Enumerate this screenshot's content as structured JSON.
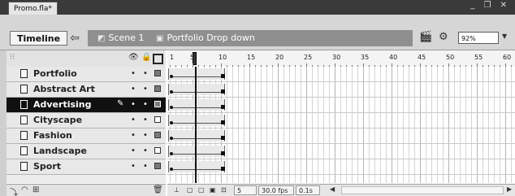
{
  "window": {
    "doc_tab": "Promo.fla*",
    "controls": "_ ❐ ✕"
  },
  "header": {
    "timeline_label": "Timeline",
    "scene_label": "Scene 1",
    "symbol_label": "Portfolio Drop down",
    "zoom": "92%"
  },
  "layers": [
    {
      "name": "Portfolio",
      "selected": false,
      "outline": "filled"
    },
    {
      "name": "Abstract Art",
      "selected": false,
      "outline": "filled"
    },
    {
      "name": "Advertising",
      "selected": true,
      "outline": "filled"
    },
    {
      "name": "Cityscape",
      "selected": false,
      "outline": "white"
    },
    {
      "name": "Fashion",
      "selected": false,
      "outline": "filled"
    },
    {
      "name": "Landscape",
      "selected": false,
      "outline": "white"
    },
    {
      "name": "Sport",
      "selected": false,
      "outline": "filled"
    }
  ],
  "ruler": {
    "ticks": [
      "1",
      "5",
      "10",
      "15",
      "20",
      "25",
      "30",
      "35",
      "40",
      "45",
      "50",
      "55",
      "60"
    ]
  },
  "footer": {
    "current_frame": "5",
    "frame_rate": "30.0 fps",
    "elapsed": "0.1s"
  },
  "colors": {
    "selected_layer": "#111111",
    "crumb_bar": "#8f8f8f",
    "header": "#d6d6d6"
  }
}
